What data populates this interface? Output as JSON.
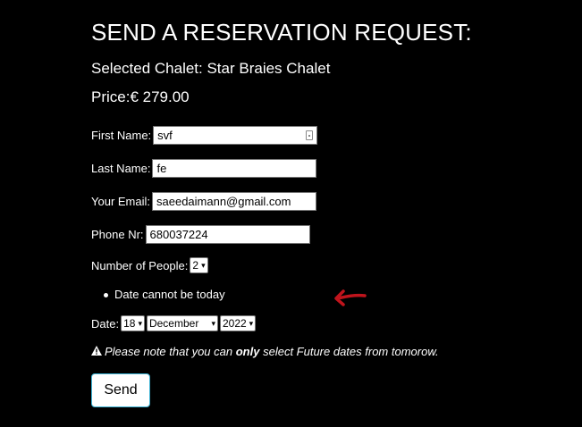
{
  "form": {
    "heading": "SEND A RESERVATION REQUEST:",
    "chalet_label": "Selected Chalet: Star Braies Chalet",
    "price_label": "Price:€ 279.00",
    "first_name": {
      "label": "First Name:",
      "value": "svf"
    },
    "last_name": {
      "label": "Last Name:",
      "value": "fe"
    },
    "email": {
      "label": "Your Email:",
      "value": "saeedaimann@gmail.com"
    },
    "phone": {
      "label": "Phone Nr:",
      "value": "680037224"
    },
    "people": {
      "label": "Number of People:",
      "value": "2"
    },
    "error": "Date cannot be today",
    "date": {
      "label": "Date:",
      "day": "18",
      "month": "December",
      "year": "2022"
    },
    "note": {
      "prefix": "Please note that you can",
      "emph": "only",
      "suffix": "select Future dates from tomorow."
    },
    "send_label": "Send"
  },
  "colors": {
    "arrow": "#c0141c",
    "send_border": "#3bb3d4"
  }
}
